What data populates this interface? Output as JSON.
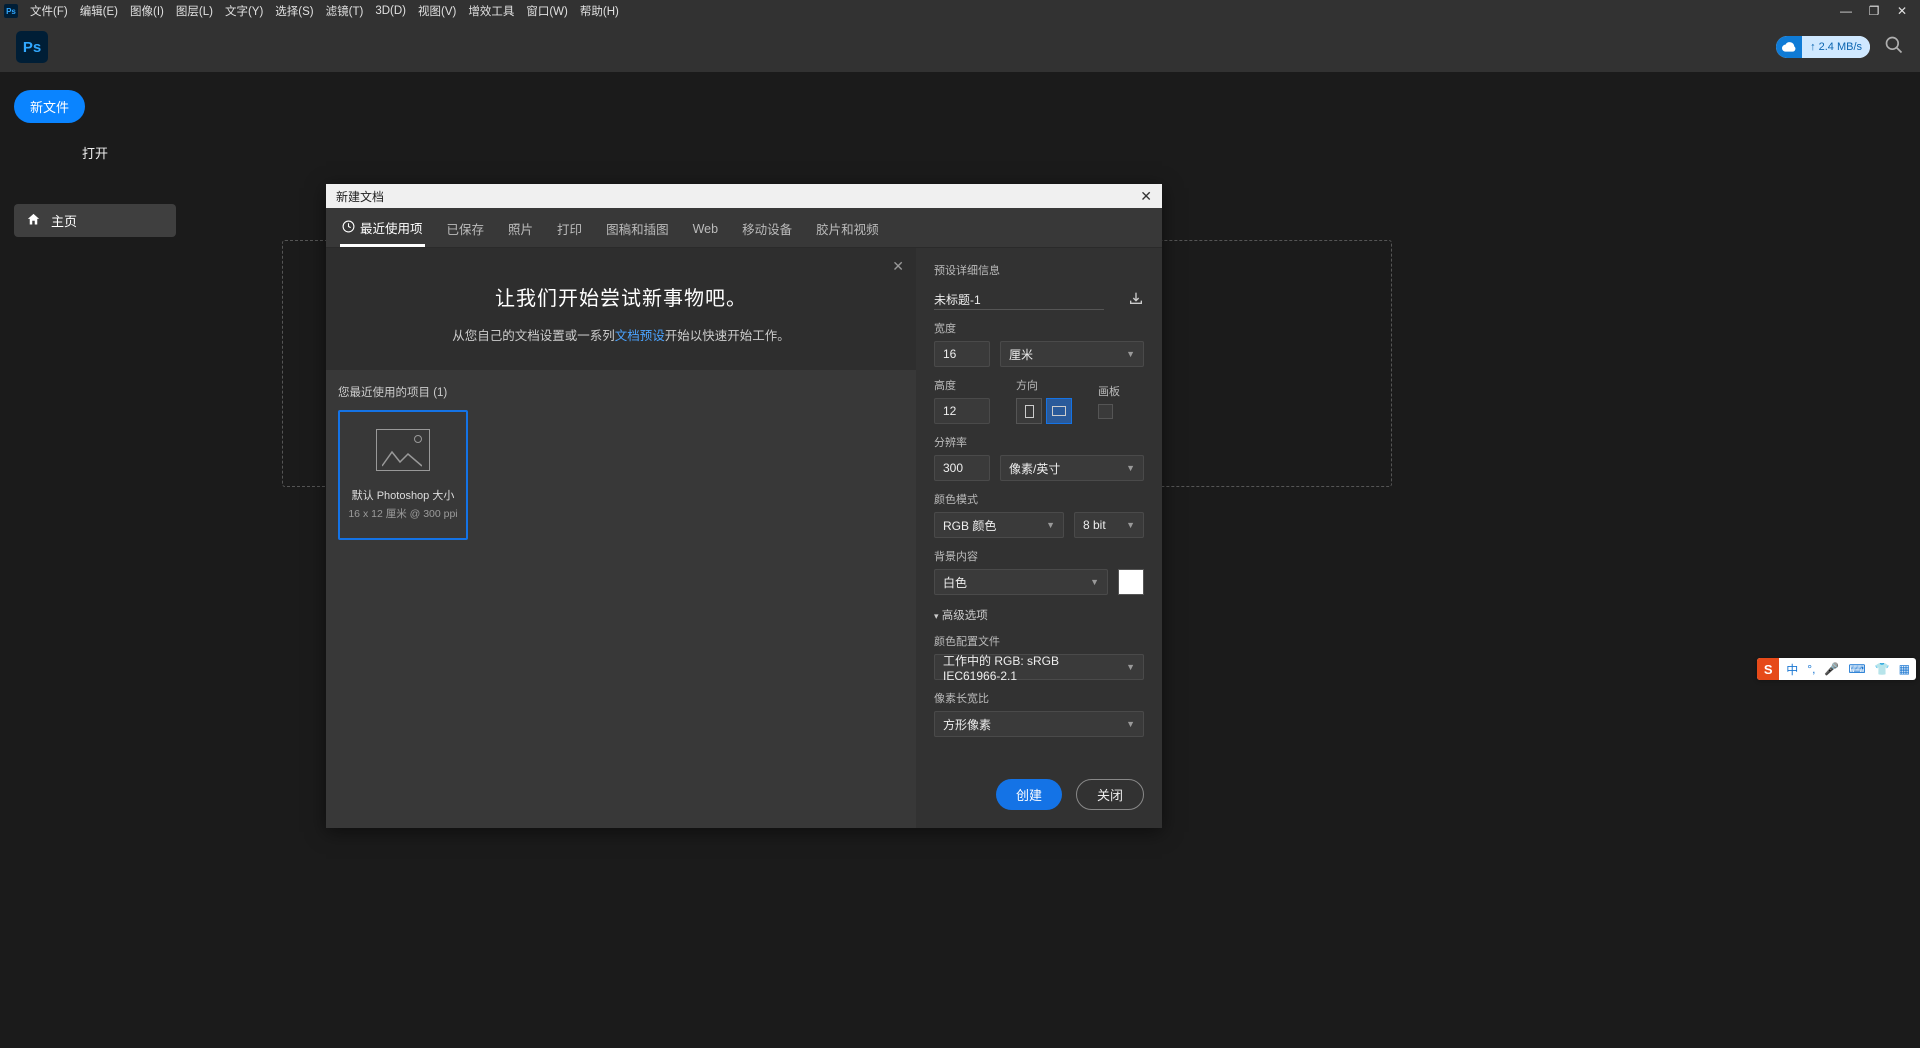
{
  "menubar": {
    "items": [
      "文件(F)",
      "编辑(E)",
      "图像(I)",
      "图层(L)",
      "文字(Y)",
      "选择(S)",
      "滤镜(T)",
      "3D(D)",
      "视图(V)",
      "增效工具",
      "窗口(W)",
      "帮助(H)"
    ]
  },
  "header": {
    "ps_text": "Ps",
    "cloud_speed": "2.4 MB/s"
  },
  "sidebar": {
    "btn_newfile": "新文件",
    "btn_open": "打开",
    "home_label": "主页"
  },
  "modal": {
    "title": "新建文档",
    "tabs": [
      "最近使用项",
      "已保存",
      "照片",
      "打印",
      "图稿和插图",
      "Web",
      "移动设备",
      "胶片和视频"
    ],
    "banner_title": "让我们开始尝试新事物吧。",
    "banner_text_pre": "从您自己的文档设置或一系列",
    "banner_link": "文档预设",
    "banner_text_post": "开始以快速开始工作。",
    "recent_label": "您最近使用的项目 (1)",
    "preset_name": "默认 Photoshop 大小",
    "preset_meta": "16 x 12 厘米 @ 300 ppi"
  },
  "form": {
    "details_title": "预设详细信息",
    "doc_name": "未标题-1",
    "width_label": "宽度",
    "width_value": "16",
    "unit_value": "厘米",
    "height_label": "高度",
    "height_value": "12",
    "orientation_label": "方向",
    "artboard_label": "画板",
    "resolution_label": "分辨率",
    "resolution_value": "300",
    "resolution_unit": "像素/英寸",
    "color_mode_label": "颜色模式",
    "color_mode_value": "RGB 颜色",
    "bit_depth": "8 bit",
    "bg_label": "背景内容",
    "bg_value": "白色",
    "advanced_label": "高级选项",
    "profile_label": "颜色配置文件",
    "profile_value": "工作中的 RGB: sRGB IEC61966-2.1",
    "pixel_ratio_label": "像素长宽比",
    "pixel_ratio_value": "方形像素",
    "btn_create": "创建",
    "btn_close": "关闭"
  },
  "ime": {
    "logo": "S",
    "lang": "中"
  }
}
